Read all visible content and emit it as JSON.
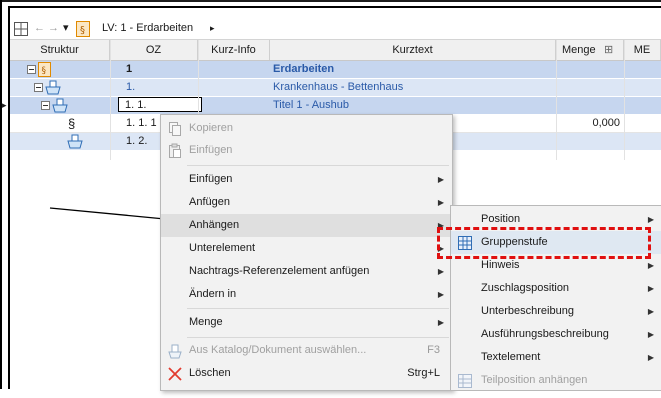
{
  "toolbar": {
    "grid_icon": "grid-icon",
    "back_arrow": "←",
    "forward_arrow": "→",
    "dropdown_arrow": "▾",
    "breadcrumb": "LV: 1 - Erdarbeiten",
    "breadcrumb_arrow": "▸"
  },
  "columns": {
    "struktur": "Struktur",
    "oz": "OZ",
    "kurzinfo": "Kurz-Info",
    "kurztext": "Kurztext",
    "menge": "Menge",
    "menge_btn": "⊞",
    "me": "ME"
  },
  "rows": [
    {
      "oz": "1",
      "kurztext": "Erdarbeiten",
      "menge": ""
    },
    {
      "oz": "1.",
      "kurztext": "Krankenhaus - Bettenhaus",
      "menge": ""
    },
    {
      "oz": "1. 1.",
      "kurztext": "Titel 1 - Aushub",
      "menge": ""
    },
    {
      "oz": "1. 1. 1",
      "kurztext": "",
      "menge": "0,000"
    },
    {
      "oz": "1. 2.",
      "kurztext": "",
      "menge": ""
    }
  ],
  "row_markers": {
    "current": "▸",
    "section": "§"
  },
  "context_menu": {
    "kopieren": "Kopieren",
    "einfuegen_disabled": "Einfügen",
    "einfuegen": "Einfügen",
    "anfuegen": "Anfügen",
    "anhaengen": "Anhängen",
    "unterelement": "Unterelement",
    "nachtrags": "Nachtrags-Referenzelement anfügen",
    "aendern_in": "Ändern in",
    "menge": "Menge",
    "aus_katalog": "Aus Katalog/Dokument auswählen...",
    "aus_katalog_shortcut": "F3",
    "loeschen": "Löschen",
    "loeschen_shortcut": "Strg+L"
  },
  "submenu": {
    "position": "Position",
    "gruppenstufe": "Gruppenstufe",
    "hinweis": "Hinweis",
    "zuschlagsposition": "Zuschlagsposition",
    "unterbeschreibung": "Unterbeschreibung",
    "ausfuehrungsbeschreibung": "Ausführungsbeschreibung",
    "textelement": "Textelement",
    "teilposition": "Teilposition anhängen"
  },
  "colors": {
    "highlight_dash": "#e01010",
    "row_blue": "#c6d6ef",
    "link_blue": "#2a5aa8"
  }
}
